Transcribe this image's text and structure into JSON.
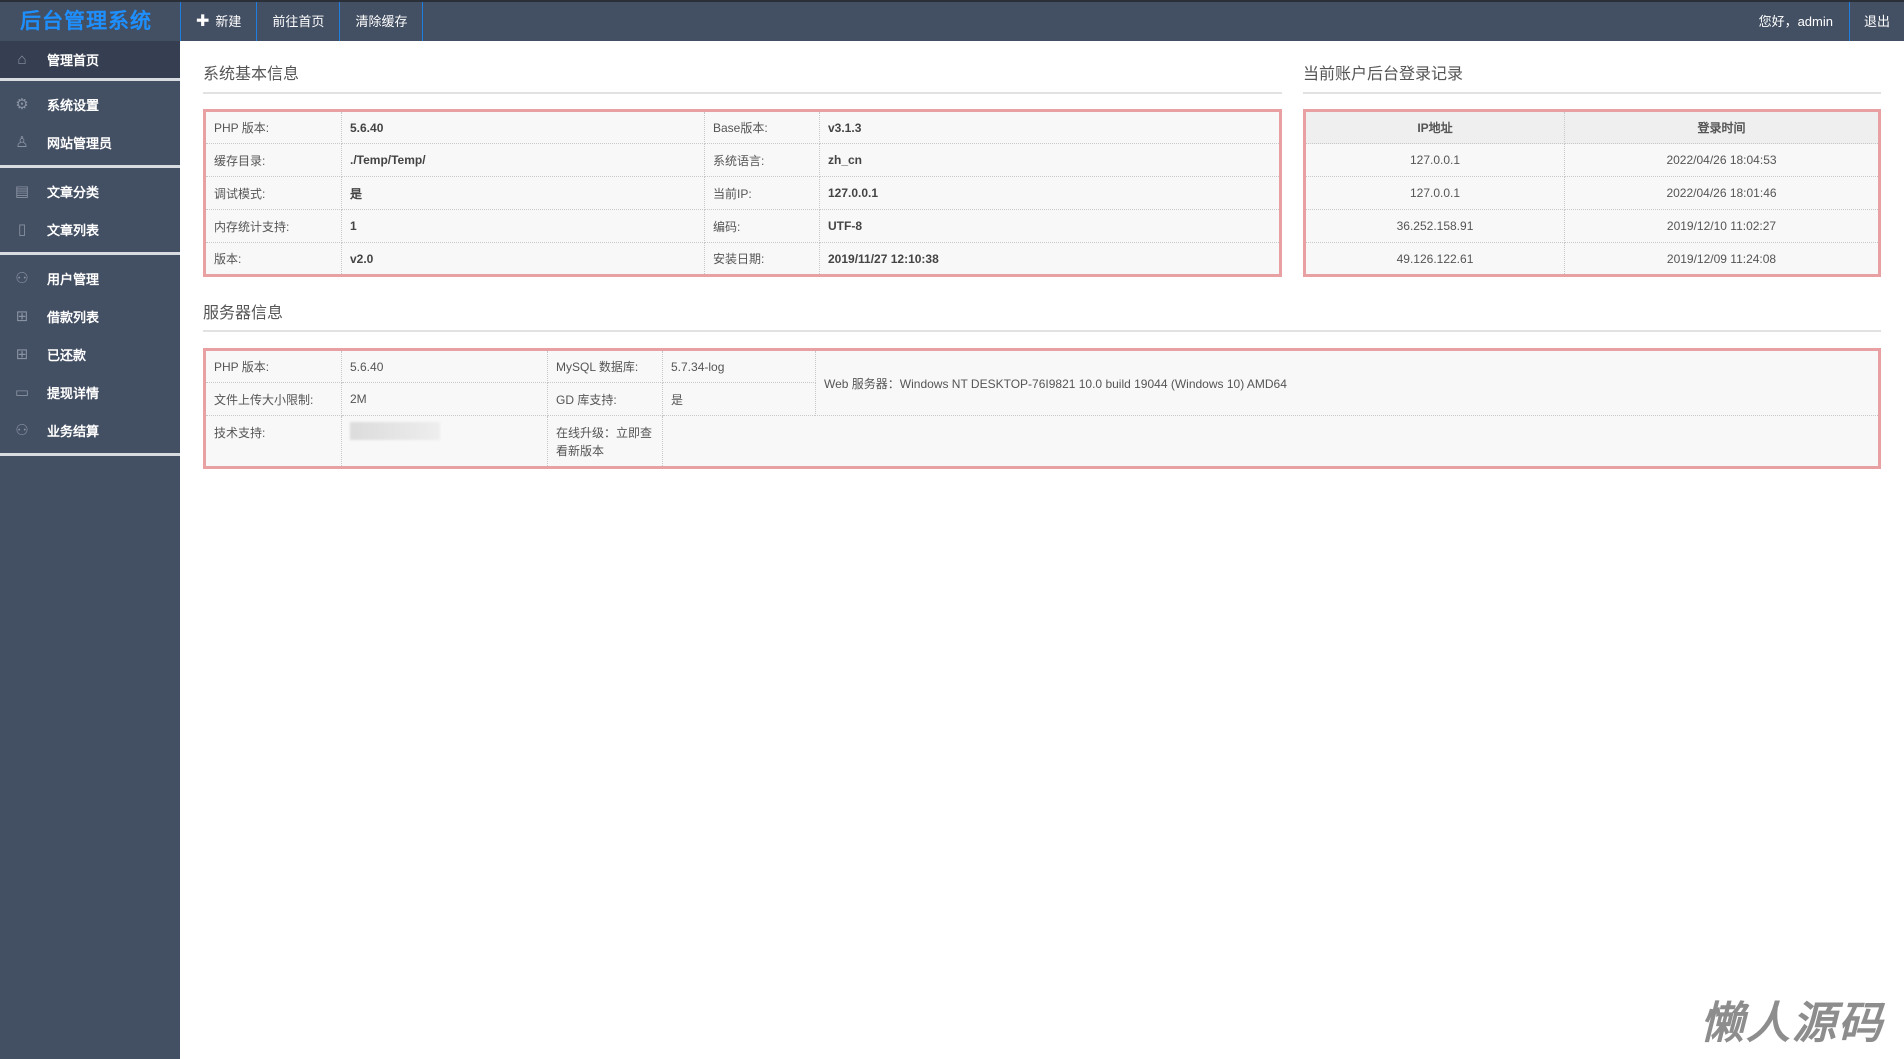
{
  "header": {
    "logo": "后台管理系统",
    "nav": [
      "新建",
      "前往首页",
      "清除缓存"
    ],
    "greeting": "您好，admin",
    "logout": "退出"
  },
  "sidebar": {
    "groups": [
      [
        {
          "label": "管理首页",
          "icon": "home-icon"
        }
      ],
      [
        {
          "label": "系统设置",
          "icon": "gear-icon"
        },
        {
          "label": "网站管理员",
          "icon": "user-icon"
        }
      ],
      [
        {
          "label": "文章分类",
          "icon": "book-icon"
        },
        {
          "label": "文章列表",
          "icon": "file-icon"
        }
      ],
      [
        {
          "label": "用户管理",
          "icon": "users-icon"
        },
        {
          "label": "借款列表",
          "icon": "grid-icon"
        },
        {
          "label": "已还款",
          "icon": "grid-icon"
        },
        {
          "label": "提现详情",
          "icon": "inbox-icon"
        },
        {
          "label": "业务结算",
          "icon": "users-icon"
        }
      ]
    ]
  },
  "system": {
    "title": "系统基本信息",
    "rows": [
      [
        "PHP 版本:",
        "5.6.40",
        "Base版本:",
        "v3.1.3"
      ],
      [
        "缓存目录:",
        "./Temp/Temp/",
        "系统语言:",
        "zh_cn"
      ],
      [
        "调试模式:",
        "是",
        "当前IP:",
        "127.0.0.1"
      ],
      [
        "内存统计支持:",
        "1",
        "编码:",
        "UTF-8"
      ],
      [
        "版本:",
        "v2.0",
        "安装日期:",
        "2019/11/27 12:10:38"
      ]
    ]
  },
  "login": {
    "title": "当前账户后台登录记录",
    "headers": [
      "IP地址",
      "登录时间"
    ],
    "rows": [
      [
        "127.0.0.1",
        "2022/04/26 18:04:53"
      ],
      [
        "127.0.0.1",
        "2022/04/26 18:01:46"
      ],
      [
        "36.252.158.91",
        "2019/12/10 11:02:27"
      ],
      [
        "49.126.122.61",
        "2019/12/09 11:24:08"
      ]
    ]
  },
  "server": {
    "title": "服务器信息",
    "php_label": "PHP 版本:",
    "php": "5.6.40",
    "mysql_label": "MySQL 数据库:",
    "mysql": "5.7.34-log",
    "upload_label": "文件上传大小限制:",
    "upload": "2M",
    "gd_label": "GD 库支持:",
    "gd": "是",
    "web": "Web 服务器：Windows NT DESKTOP-76I9821 10.0 build 19044 (Windows 10) AMD64",
    "support_label": "技术支持:",
    "upgrade": "在线升级：立即查看新版本"
  },
  "watermark": "懒人源码"
}
